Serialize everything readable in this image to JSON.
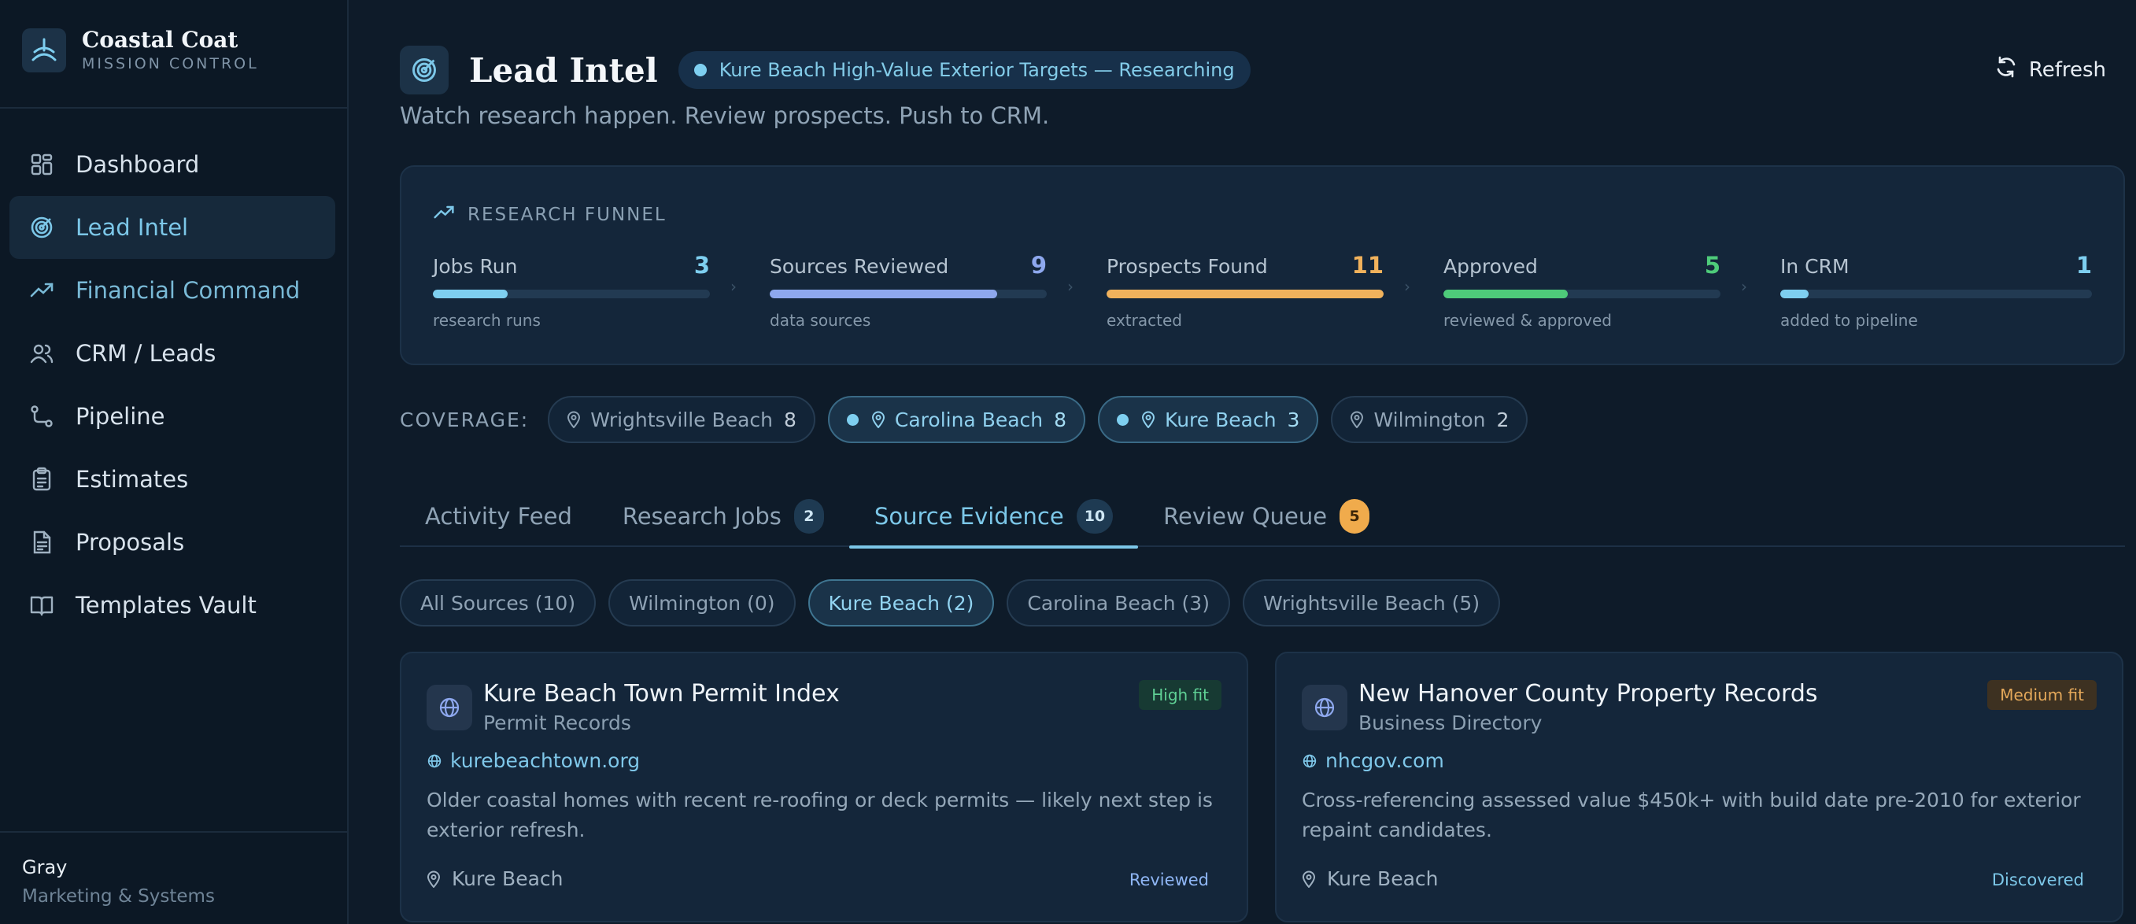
{
  "brand": {
    "name": "Coastal Coat",
    "subtitle": "MISSION CONTROL"
  },
  "nav": [
    {
      "label": "Dashboard",
      "icon": "dashboard-grid-icon"
    },
    {
      "label": "Lead Intel",
      "icon": "target-icon",
      "active": true
    },
    {
      "label": "Financial Command",
      "icon": "trending-up-icon"
    },
    {
      "label": "CRM / Leads",
      "icon": "users-icon"
    },
    {
      "label": "Pipeline",
      "icon": "pipeline-icon"
    },
    {
      "label": "Estimates",
      "icon": "clipboard-icon"
    },
    {
      "label": "Proposals",
      "icon": "document-icon"
    },
    {
      "label": "Templates Vault",
      "icon": "book-icon"
    }
  ],
  "user": {
    "name": "Gray",
    "role": "Marketing & Systems"
  },
  "header": {
    "title": "Lead Intel",
    "status": "Kure Beach High-Value Exterior Targets — Researching",
    "subtitle": "Watch research happen. Review prospects. Push to CRM.",
    "refresh_label": "Refresh"
  },
  "funnel": {
    "title": "RESEARCH FUNNEL",
    "stages": [
      {
        "label": "Jobs Run",
        "count": "3",
        "sub": "research runs",
        "fill": 0.27,
        "color": "#7ecff0"
      },
      {
        "label": "Sources Reviewed",
        "count": "9",
        "sub": "data sources",
        "fill": 0.82,
        "color": "#8ea8ee"
      },
      {
        "label": "Prospects Found",
        "count": "11",
        "sub": "extracted",
        "fill": 1.0,
        "color": "#f1b25c"
      },
      {
        "label": "Approved",
        "count": "5",
        "sub": "reviewed & approved",
        "fill": 0.45,
        "color": "#4ecb7a"
      },
      {
        "label": "In CRM",
        "count": "1",
        "sub": "added to pipeline",
        "fill": 0.09,
        "color": "#7ecff0"
      }
    ]
  },
  "coverage": {
    "label": "COVERAGE:",
    "chips": [
      {
        "label": "Wrightsville Beach",
        "count": "8",
        "selected": false
      },
      {
        "label": "Carolina Beach",
        "count": "8",
        "selected": true
      },
      {
        "label": "Kure Beach",
        "count": "3",
        "selected": true
      },
      {
        "label": "Wilmington",
        "count": "2",
        "selected": false
      }
    ]
  },
  "tabs": [
    {
      "label": "Activity Feed",
      "badge": ""
    },
    {
      "label": "Research Jobs",
      "badge": "2"
    },
    {
      "label": "Source Evidence",
      "badge": "10",
      "active": true
    },
    {
      "label": "Review Queue",
      "badge": "5",
      "badge_color": "orange"
    }
  ],
  "filters": [
    {
      "label": "All Sources (10)"
    },
    {
      "label": "Wilmington (0)"
    },
    {
      "label": "Kure Beach (2)",
      "selected": true
    },
    {
      "label": "Carolina Beach (3)"
    },
    {
      "label": "Wrightsville Beach (5)"
    }
  ],
  "cards": [
    {
      "title": "Kure Beach Town Permit Index",
      "category": "Permit Records",
      "fit": "High fit",
      "link": "kurebeachtown.org",
      "description": "Older coastal homes with recent re-roofing or deck permits — likely next step is exterior refresh.",
      "location": "Kure Beach",
      "status": "Reviewed"
    },
    {
      "title": "New Hanover County Property Records",
      "category": "Business Directory",
      "fit": "Medium fit",
      "link": "nhcgov.com",
      "description": "Cross-referencing assessed value $450k+ with build date pre-2010 for exterior repaint candidates.",
      "location": "Kure Beach",
      "status": "Discovered"
    }
  ]
}
